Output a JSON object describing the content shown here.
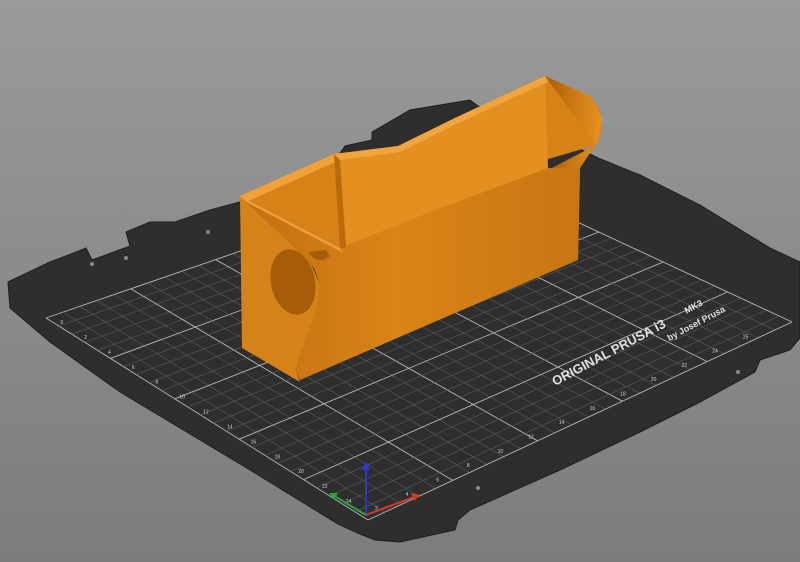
{
  "viewport": {
    "background_top": "#9a9a9a",
    "background_bottom": "#7c7c7c"
  },
  "bed": {
    "brand_line": "ORIGINAL PRUSA i3",
    "model": "MK3",
    "maker": "by Josef Prusa",
    "sheet_color": "#2e2e2e",
    "grid_minor_color": "#5c5c5c",
    "grid_major_color": "#b8b8b8",
    "label_color": "#d0d0d0",
    "x_ruler_labels": [
      "0",
      "2",
      "4",
      "6",
      "8",
      "10",
      "12",
      "14",
      "16",
      "18",
      "20",
      "22",
      "24"
    ],
    "y_ruler_labels": [
      "2",
      "4",
      "6",
      "8",
      "10",
      "12",
      "14",
      "16",
      "18",
      "20",
      "22",
      "24",
      "25"
    ]
  },
  "model_part": {
    "name": "hollow box",
    "color_face_light": "#e08a1c",
    "color_face_mid": "#c9740f",
    "color_face_dark": "#a85e08",
    "color_inner": "#d27d14"
  },
  "axes": {
    "x_color": "#d33a2c",
    "y_color": "#2fa33a",
    "z_color": "#2a3ad0"
  }
}
